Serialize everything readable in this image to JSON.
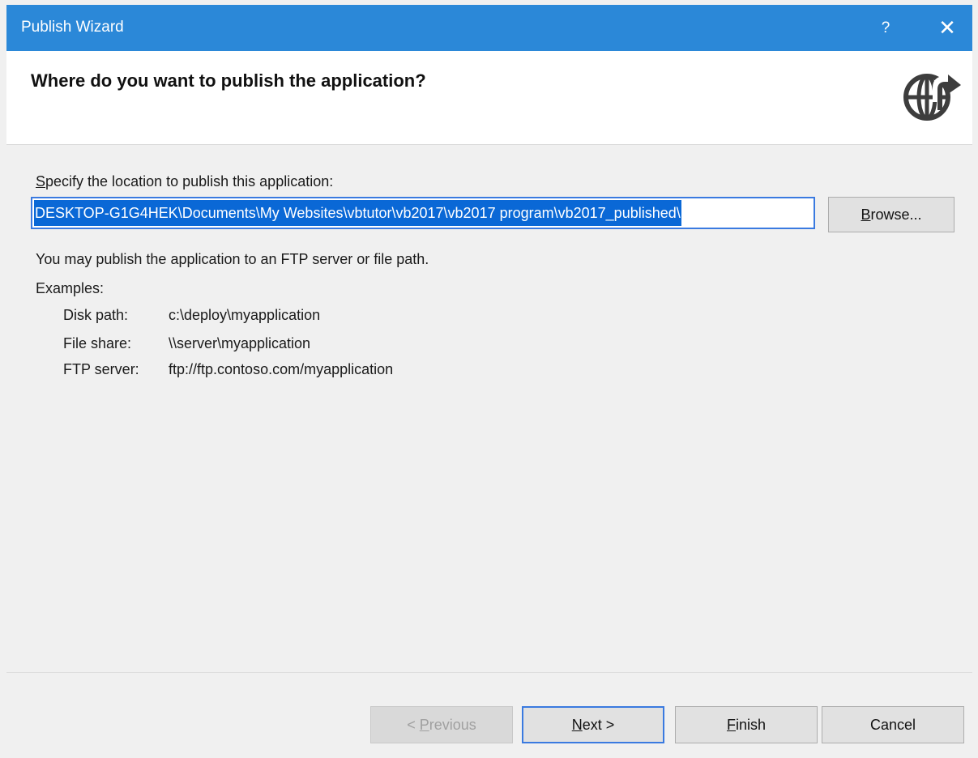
{
  "titlebar": {
    "title": "Publish Wizard",
    "help_label": "?",
    "close_label": "✕"
  },
  "header": {
    "heading": "Where do you want to publish the application?",
    "icon": "globe-upload-icon"
  },
  "location": {
    "label_prefix": "S",
    "label_rest": "pecify the location to publish this application:",
    "path_value": "DESKTOP-G1G4HEK\\Documents\\My Websites\\vbtutor\\vb2017\\vb2017 program\\vb2017_published\\",
    "browse_prefix": "B",
    "browse_rest": "rowse..."
  },
  "info": {
    "note": "You may publish the application to an FTP server or file path.",
    "examples_label": "Examples:",
    "examples": [
      {
        "label": "Disk path:",
        "value": "c:\\deploy\\myapplication"
      },
      {
        "label": "File share:",
        "value": "\\\\server\\myapplication"
      },
      {
        "label": "FTP server:",
        "value": "ftp://ftp.contoso.com/myapplication"
      }
    ]
  },
  "footer": {
    "previous_before": "< ",
    "previous_underlined": "P",
    "previous_after": "revious",
    "next_underlined": "N",
    "next_after": "ext >",
    "finish_underlined": "F",
    "finish_after": "inish",
    "cancel": "Cancel"
  },
  "colors": {
    "titlebar": "#2b88d8",
    "selection": "#0a68d6",
    "focus_border": "#3a7ae0"
  }
}
